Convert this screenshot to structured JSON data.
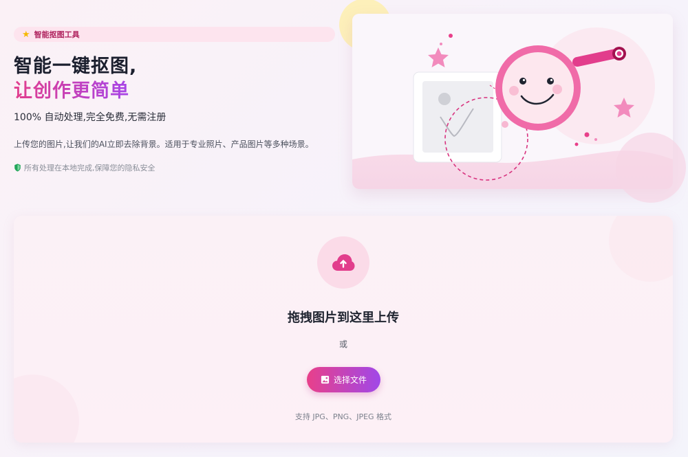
{
  "hero": {
    "badge_label": "智能抠图工具",
    "badge_icon": "star-icon",
    "title_line1": "智能一键抠图,",
    "title_line2": "让创作更简单",
    "subline": "100% 自动处理,完全免费,无需注册",
    "description": "上传您的图片,让我们的AI立即去除背景。适用于专业照片、产品图片等多种场景。",
    "privacy_note": "所有处理在本地完成,保障您的隐私安全",
    "privacy_icon": "shield-icon"
  },
  "upload": {
    "icon": "cloud-upload-icon",
    "title": "拖拽图片到这里上传",
    "or_text": "或",
    "button_label": "选择文件",
    "button_icon": "image-icon",
    "formats_text": "支持 JPG、PNG、JPEG 格式"
  },
  "colors": {
    "accent_pink": "#e8408a",
    "accent_purple": "#a048e8",
    "badge_bg": "#fde4ee",
    "star": "#f5b800",
    "shield": "#22a65a"
  }
}
